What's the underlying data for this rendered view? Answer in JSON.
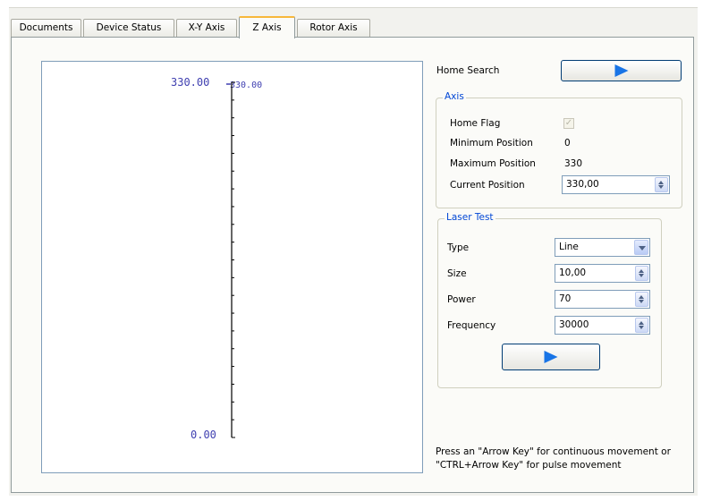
{
  "tabs": [
    "Documents",
    "Device Status",
    "X-Y Axis",
    "Z Axis",
    "Rotor Axis"
  ],
  "active_tab": "Z Axis",
  "scale": {
    "top_value": "330.00",
    "top_marker": "330.00",
    "bottom_value": "0.00"
  },
  "home_search": {
    "label": "Home Search"
  },
  "axis": {
    "title": "Axis",
    "home_flag_label": "Home Flag",
    "home_flag_checked": true,
    "min_label": "Minimum Position",
    "min_value": "0",
    "max_label": "Maximum Position",
    "max_value": "330",
    "current_label": "Current Position",
    "current_value": "330,00"
  },
  "laser_test": {
    "title": "Laser Test",
    "type_label": "Type",
    "type_value": "Line",
    "size_label": "Size",
    "size_value": "10,00",
    "power_label": "Power",
    "power_value": "70",
    "frequency_label": "Frequency",
    "frequency_value": "30000"
  },
  "hint": {
    "line1": "Press an \"Arrow Key\" for continuous movement or",
    "line2": "\"CTRL+Arrow Key\" for pulse movement"
  },
  "colors": {
    "play_icon": "#1874e6",
    "group_title": "#0046d5",
    "scale_text": "#3f3fb0",
    "active_tab_accent": "#f7b83b"
  }
}
